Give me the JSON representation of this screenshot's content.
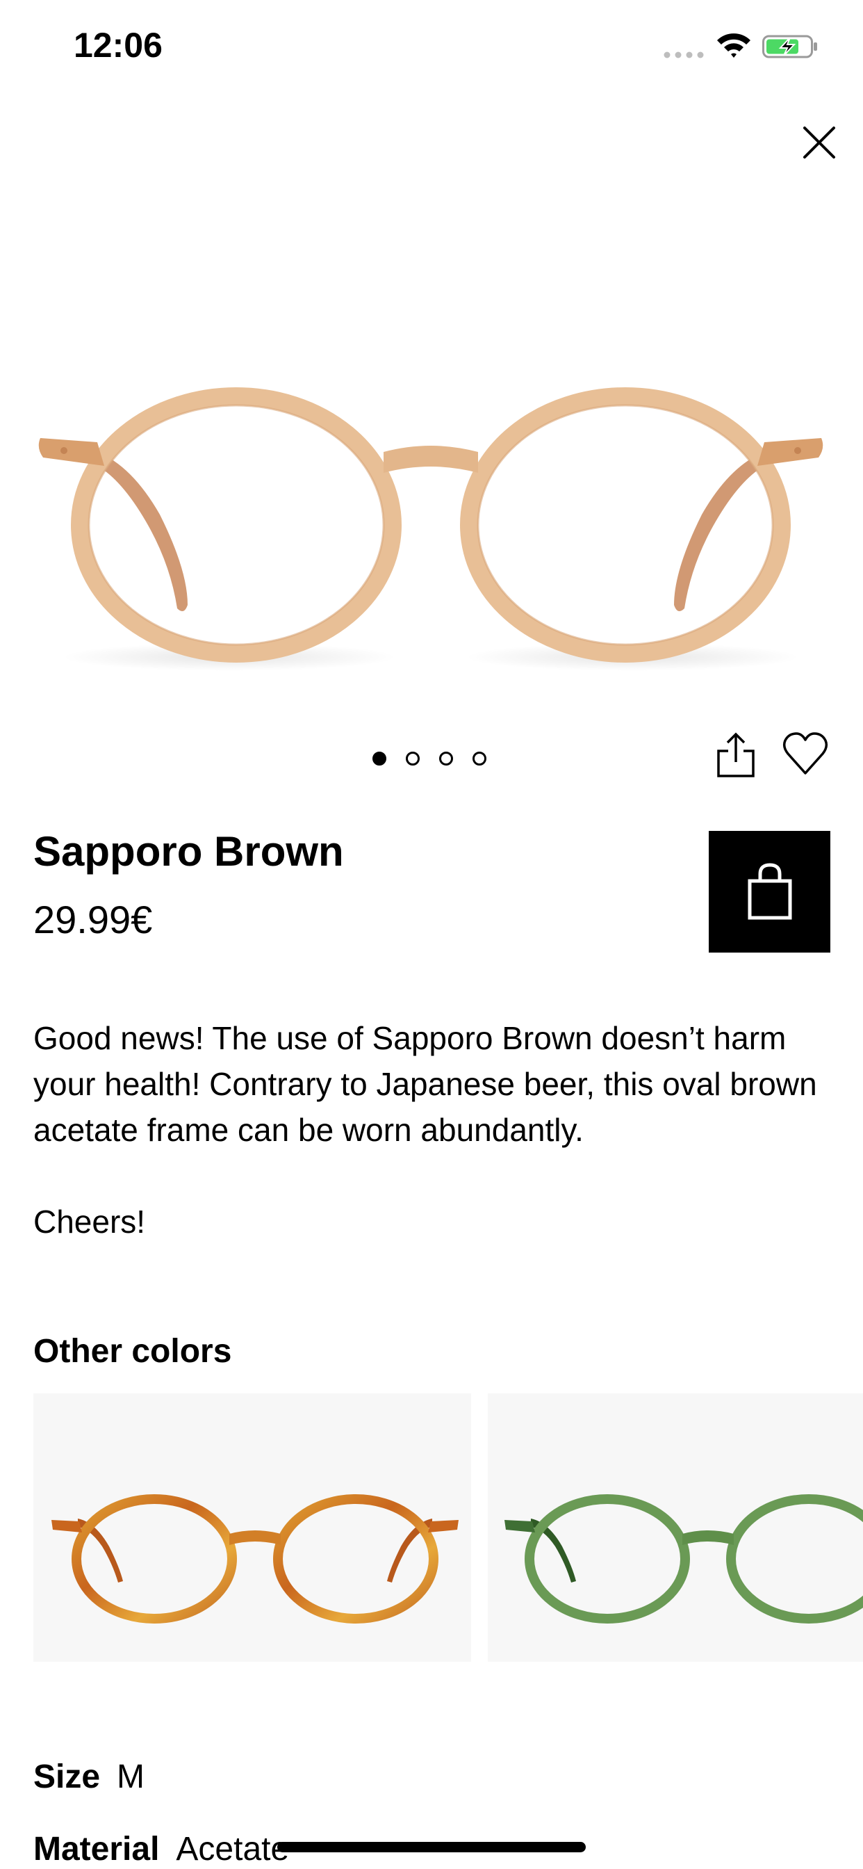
{
  "status_bar": {
    "time": "12:06",
    "icons": [
      "signal-dots-icon",
      "wifi-icon",
      "battery-charging-icon"
    ],
    "battery_color": "#4cd964"
  },
  "product": {
    "name": "Sapporo Brown",
    "price": "29.99€",
    "frame_color": "#e6b98f",
    "description": [
      "Good news! The use of Sapporo Brown doesn’t harm your health! Contrary to Japanese beer, this oval brown acetate frame can be worn abundantly.",
      "Cheers!"
    ]
  },
  "carousel": {
    "count": 4,
    "active_index": 0
  },
  "actions": {
    "icons": [
      "close-icon",
      "share-icon",
      "heart-icon",
      "shopping-bag-icon"
    ]
  },
  "other_colors": {
    "heading": "Other colors",
    "items": [
      {
        "frame_color": "#d98a2b",
        "icon": "tortoise-glasses"
      },
      {
        "frame_color": "#5f8f4a",
        "icon": "green-glasses"
      }
    ]
  },
  "specs": {
    "size_label": "Size",
    "size_value": "M",
    "material_label": "Material",
    "material_value": "Acetate"
  }
}
